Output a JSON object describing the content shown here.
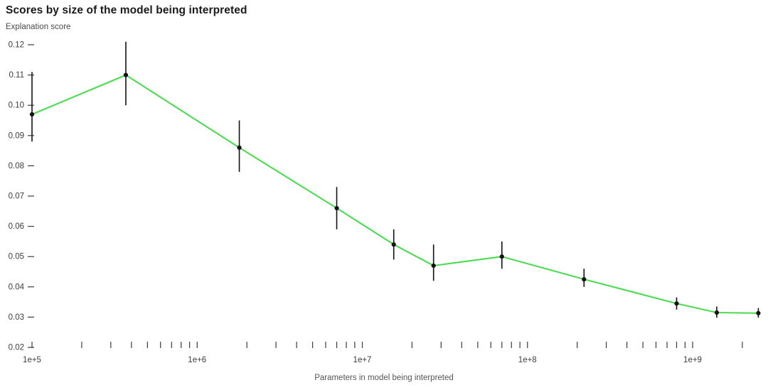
{
  "chart_data": {
    "type": "line",
    "title": "Scores by size of the model being interpreted",
    "subtitle": "Explanation score",
    "ylabel": "Explanation score",
    "xlabel": "Parameters in model being interpreted",
    "xscale": "log",
    "xlim": [
      100000,
      2500000000
    ],
    "ylim": [
      0.02,
      0.123
    ],
    "grid": false,
    "legend": null,
    "series_color": "#4ddb53",
    "marker_color": "#111111",
    "errorbar_color": "#111111",
    "y_ticks": [
      "0.02",
      "0.03",
      "0.04",
      "0.05",
      "0.06",
      "0.07",
      "0.08",
      "0.09",
      "0.10",
      "0.11",
      "0.12"
    ],
    "y_tick_values": [
      0.02,
      0.03,
      0.04,
      0.05,
      0.06,
      0.07,
      0.08,
      0.09,
      0.1,
      0.11,
      0.12
    ],
    "x_ticks": [
      "1e+5",
      "1e+6",
      "1e+7",
      "1e+8",
      "1e+9"
    ],
    "x_tick_values": [
      100000,
      1000000,
      10000000,
      100000000,
      1000000000
    ],
    "x": [
      100000,
      370000,
      1800000,
      7000000,
      15500000,
      27000000,
      70000000,
      220000000,
      800000000,
      1400000000,
      2500000000
    ],
    "y": [
      0.097,
      0.11,
      0.086,
      0.066,
      0.054,
      0.047,
      0.05,
      0.0425,
      0.0345,
      0.0315,
      0.0313
    ],
    "y_err_low": [
      0.088,
      0.1,
      0.078,
      0.059,
      0.049,
      0.042,
      0.046,
      0.04,
      0.0325,
      0.0298,
      0.0298
    ],
    "y_err_high": [
      0.111,
      0.121,
      0.095,
      0.073,
      0.059,
      0.054,
      0.055,
      0.046,
      0.0365,
      0.0335,
      0.033
    ]
  }
}
